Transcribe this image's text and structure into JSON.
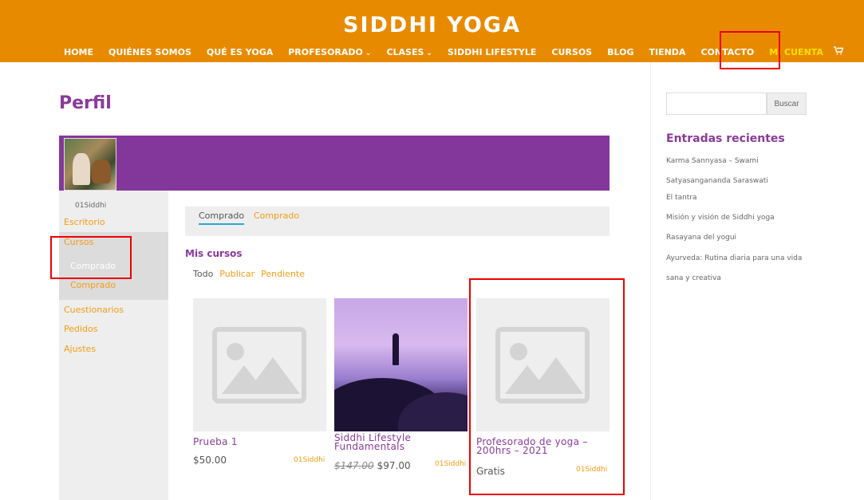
{
  "site": {
    "logo": "SIDDHI YOGA"
  },
  "nav": {
    "items": [
      {
        "label": "HOME"
      },
      {
        "label": "QUIÉNES SOMOS"
      },
      {
        "label": "QUÉ ES YOGA"
      },
      {
        "label": "PROFESORADO",
        "dropdown": true
      },
      {
        "label": "CLASES",
        "dropdown": true
      },
      {
        "label": "SIDDHI LIFESTYLE"
      },
      {
        "label": "CURSOS"
      },
      {
        "label": "BLOG"
      },
      {
        "label": "TIENDA"
      },
      {
        "label": "CONTACTO"
      },
      {
        "label": "MI CUENTA",
        "active": true
      }
    ],
    "cart_icon": "cart-icon"
  },
  "profile": {
    "title": "Perfil",
    "username": "01Siddhi",
    "menu": {
      "escritorio": "Escritorio",
      "cursos": "Cursos",
      "cursos_sub_1": "Comprado",
      "cursos_sub_2": "Comprado",
      "cuestionarios": "Cuestionarios",
      "pedidos": "Pedidos",
      "ajustes": "Ajustes"
    }
  },
  "tabs": {
    "tab1": "Comprado",
    "tab2": "Comprado"
  },
  "courses": {
    "section_title": "Mis cursos",
    "filters": {
      "all": "Todo",
      "publish": "Publicar",
      "pending": "Pendiente"
    },
    "items": [
      {
        "title_line1": "Prueba 1",
        "title_line2": "",
        "price": "$50.00",
        "old_price": "",
        "author": "01Siddhi"
      },
      {
        "title_line1": "Siddhi Lifestyle",
        "title_line2": "Fundamentals",
        "price": "$97.00",
        "old_price": "$147.00",
        "author": "01Siddhi"
      },
      {
        "title_line1": "Profesorado de yoga –",
        "title_line2": "200hrs – 2021",
        "price": "Gratis",
        "old_price": "",
        "author": "01Siddhi"
      }
    ]
  },
  "sidebar": {
    "search_button": "Buscar",
    "recent_title": "Entradas recientes",
    "recent": [
      "Karma Sannyasa – Swami Satyasangananda Saraswati",
      "El tantra",
      "Misión y visión de Siddhi yoga",
      "Rasayana del yogui",
      "Ayurveda: Rutina diaria para una vida sana y creativa"
    ]
  },
  "colors": {
    "header": "#e88a00",
    "accent": "#f39c12",
    "brand_purple": "#8a3a9a",
    "cover": "#84379a",
    "highlight_box": "#e00000"
  }
}
